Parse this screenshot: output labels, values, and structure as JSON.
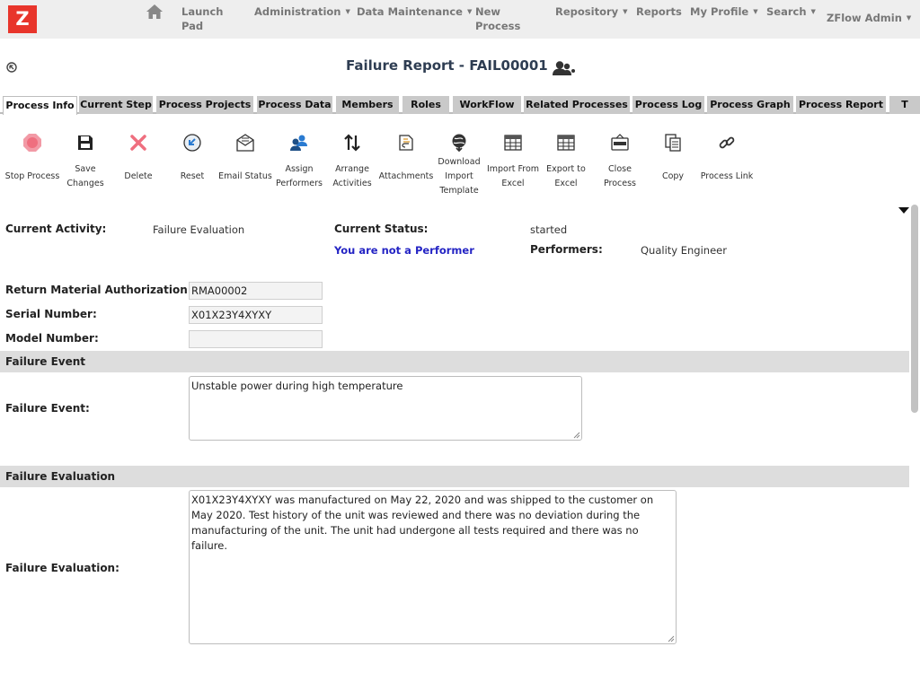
{
  "nav": {
    "logo": "Z",
    "items": [
      {
        "label": "Launch\nPad",
        "caret": false
      },
      {
        "label": "Administration",
        "caret": true
      },
      {
        "label": "Data Maintenance",
        "caret": true
      },
      {
        "label": "New\nProcess",
        "caret": false
      },
      {
        "label": "Repository",
        "caret": true
      },
      {
        "label": "Reports",
        "caret": false
      },
      {
        "label": "My Profile",
        "caret": true
      },
      {
        "label": "Search",
        "caret": true
      },
      {
        "label": "ZFlow Admin",
        "caret": true
      }
    ]
  },
  "page": {
    "title": "Failure Report - FAIL00001"
  },
  "tabs": [
    {
      "label": "Process Info",
      "active": true
    },
    {
      "label": "Current Step"
    },
    {
      "label": "Process Projects"
    },
    {
      "label": "Process Data"
    },
    {
      "label": "Members"
    },
    {
      "label": "Roles"
    },
    {
      "label": "WorkFlow"
    },
    {
      "label": "Related Processes"
    },
    {
      "label": "Process Log"
    },
    {
      "label": "Process Graph"
    },
    {
      "label": "Process Report"
    },
    {
      "label": "T"
    }
  ],
  "toolbar": [
    {
      "label": "Stop Process",
      "icon": "stop-icon"
    },
    {
      "label": "Save\nChanges",
      "icon": "save-icon"
    },
    {
      "label": "Delete",
      "icon": "delete-icon"
    },
    {
      "label": "Reset",
      "icon": "reset-icon"
    },
    {
      "label": "Email Status",
      "icon": "email-icon"
    },
    {
      "label": "Assign\nPerformers",
      "icon": "assign-performers-icon"
    },
    {
      "label": "Arrange\nActivities",
      "icon": "arrange-icon"
    },
    {
      "label": "Attachments",
      "icon": "attachments-icon"
    },
    {
      "label": "Download\nImport\nTemplate",
      "icon": "download-icon"
    },
    {
      "label": "Import From\nExcel",
      "icon": "import-excel-icon"
    },
    {
      "label": "Export to\nExcel",
      "icon": "export-excel-icon"
    },
    {
      "label": "Close\nProcess",
      "icon": "close-process-icon"
    },
    {
      "label": "Copy",
      "icon": "copy-icon"
    },
    {
      "label": "Process Link",
      "icon": "link-icon"
    }
  ],
  "status": {
    "current_activity_label": "Current Activity:",
    "current_activity_value": "Failure Evaluation",
    "current_status_label": "Current Status:",
    "current_status_value": "started",
    "not_performer": "You are not a Performer",
    "performers_label": "Performers:",
    "performers_value": "Quality Engineer"
  },
  "form": {
    "rma_label": "Return Material Authorization:",
    "rma_value": "RMA00002",
    "serial_label": "Serial Number:",
    "serial_value": "X01X23Y4XYXY",
    "model_label": "Model Number:",
    "model_value": "",
    "failure_event_section": "Failure Event",
    "failure_event_label": "Failure Event:",
    "failure_event_value": "Unstable power during high temperature",
    "failure_eval_section": "Failure Evaluation",
    "failure_eval_label": "Failure Evaluation:",
    "failure_eval_value": "X01X23Y4XYXY was manufactured on May 22, 2020 and was shipped to the customer on May 2020. Test history of the unit was reviewed and there was no deviation during the manufacturing of the unit. The unit had undergone all tests required and there was no failure."
  },
  "colors": {
    "logo": "#e8352b",
    "title": "#2e3d52",
    "not_performer": "#2424c4",
    "stop": "#ef6f7f",
    "delete": "#ef6f7f"
  }
}
